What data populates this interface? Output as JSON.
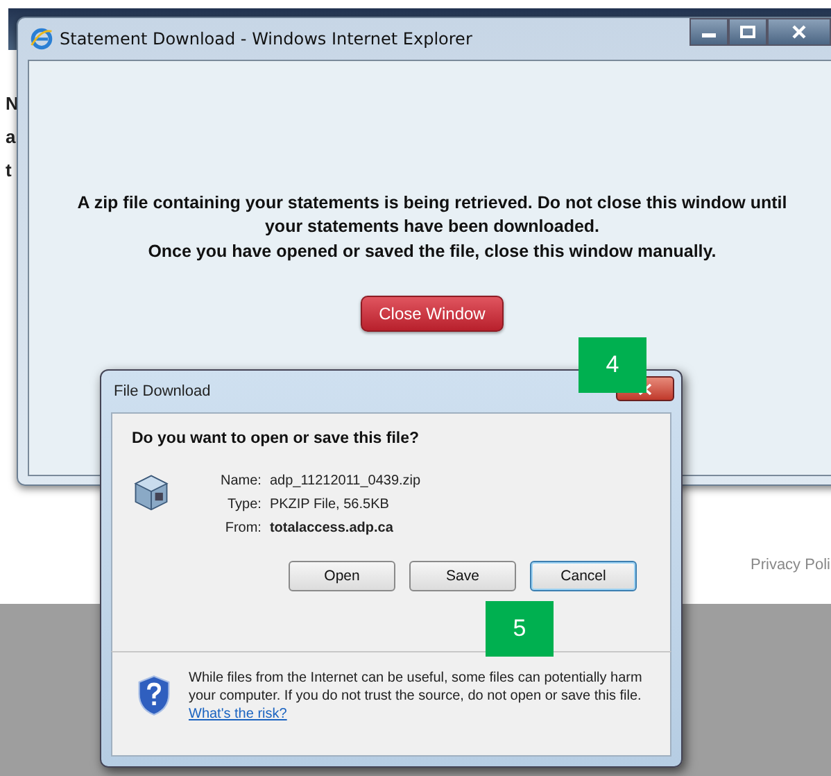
{
  "background_page": {
    "fragments": [
      "N",
      "a",
      "t"
    ],
    "footer_link": "Privacy Poli"
  },
  "ie_window": {
    "title": "Statement Download - Windows Internet Explorer",
    "message_lines": [
      "A zip file containing your statements is being retrieved. Do not close this window until your statements have been downloaded.",
      "Once you have opened or saved the file, close this window manually."
    ],
    "close_button": "Close Window"
  },
  "file_download_dialog": {
    "title": "File Download",
    "question": "Do you want to open or save this file?",
    "fields": [
      {
        "label": "Name:",
        "value": "adp_11212011_0439.zip",
        "bold": false
      },
      {
        "label": "Type:",
        "value": "PKZIP File, 56.5KB",
        "bold": false
      },
      {
        "label": "From:",
        "value": "totalaccess.adp.ca",
        "bold": true
      }
    ],
    "buttons": [
      {
        "label": "Open",
        "focused": false
      },
      {
        "label": "Save",
        "focused": false
      },
      {
        "label": "Cancel",
        "focused": true
      }
    ],
    "warning": "While files from the Internet can be useful, some files can potentially harm your computer. If you do not trust the source, do not open or save this file.",
    "risk_link": "What's the risk?"
  },
  "step_markers": [
    {
      "label": "4",
      "kind": "near-close"
    },
    {
      "label": "5",
      "kind": "near-save"
    }
  ]
}
